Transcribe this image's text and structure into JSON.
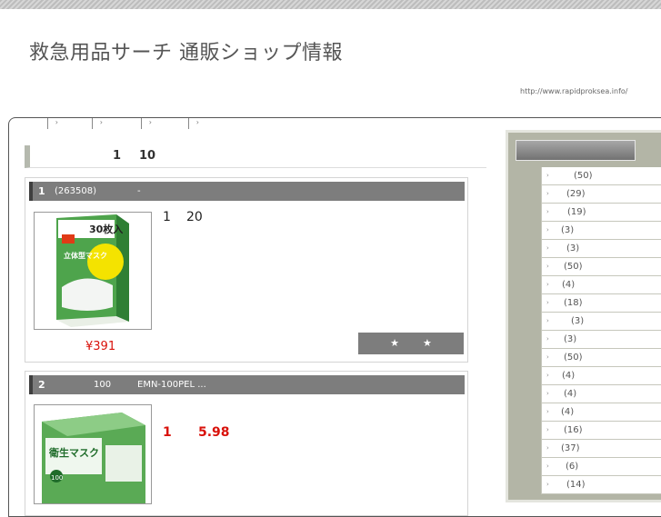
{
  "site": {
    "title": "救急用品サーチ 通販ショップ情報",
    "url": "http://www.rapidproksea.info/"
  },
  "gnav": [
    {
      "arrow": "›"
    },
    {
      "arrow": "›"
    },
    {
      "arrow": "›"
    },
    {
      "arrow": "›"
    }
  ],
  "breadcrumb": {
    "left": "1",
    "right": "10"
  },
  "items": [
    {
      "rank": "1",
      "head_a": "(263508)",
      "head_b": "-",
      "desc_a": "1",
      "desc_b": "20",
      "price": "¥391",
      "stars": "★★",
      "product_label": "30枚入",
      "product_name": "立体型マスク"
    },
    {
      "rank": "2",
      "head_a": "100",
      "head_b": "EMN-100PEL ...",
      "desc_a": "1",
      "desc_b": "5.98",
      "product_name": "衛生マスク",
      "product_count": "100"
    }
  ],
  "sidebar": {
    "categories": [
      {
        "count": "(50)"
      },
      {
        "count": "(29)"
      },
      {
        "count": "(19)"
      },
      {
        "count": "(3)"
      },
      {
        "count": "(3)"
      },
      {
        "count": "(50)"
      },
      {
        "count": "(4)"
      },
      {
        "count": "(18)"
      },
      {
        "count": "(3)"
      },
      {
        "count": "(3)"
      },
      {
        "count": "(50)"
      },
      {
        "count": "(4)"
      },
      {
        "count": "(4)"
      },
      {
        "count": "(4)"
      },
      {
        "count": "(16)"
      },
      {
        "count": "(37)"
      },
      {
        "count": "(6)"
      },
      {
        "count": "(14)"
      }
    ]
  },
  "colors": {
    "accent": "#d9120b",
    "bar": "#7d7d7d",
    "sidebar": "#b3b5a6"
  }
}
